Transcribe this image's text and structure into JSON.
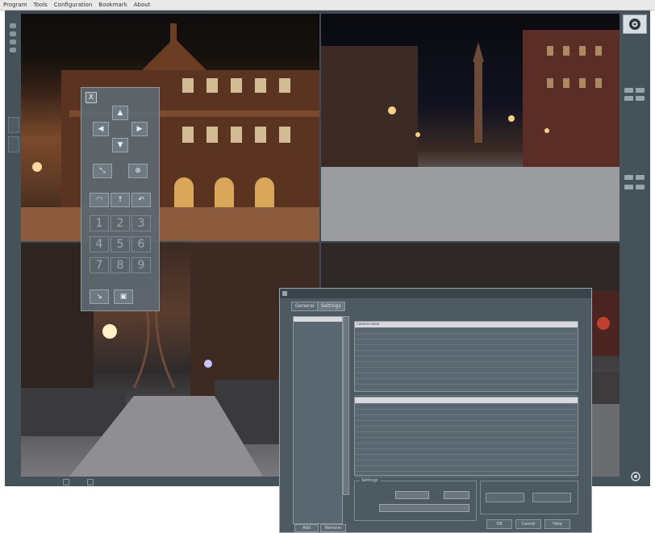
{
  "menu": [
    "Program",
    "Tools",
    "Configuration",
    "Bookmark",
    "About"
  ],
  "ptz": {
    "close_label": "X",
    "numbers": [
      "1",
      "2",
      "3",
      "4",
      "5",
      "6",
      "7",
      "8",
      "9"
    ]
  },
  "dialog": {
    "tabs": [
      "General",
      "Settings"
    ],
    "list_header": "",
    "list_items": [
      "",
      "",
      "",
      "",
      "",
      "",
      "",
      "",
      "",
      "",
      "",
      "",
      "",
      "",
      "",
      "",
      "",
      "",
      "",
      "",
      "",
      "",
      "",
      "",
      "",
      "",
      "",
      "",
      "",
      "",
      ""
    ],
    "table1_header": {
      "col1": "Camera name",
      "col2": "",
      "col3": ""
    },
    "table1_rows": 16,
    "table2_rows": 14,
    "btn_add": "Add",
    "btn_remove": "Remove",
    "btn_ok": "OK",
    "btn_cancel": "Cancel",
    "btn_help": "Help",
    "grp_left": "Settings",
    "grp_right": "",
    "btn_right1": "",
    "btn_right2": ""
  },
  "colors": {
    "app_bg": "#3f4a52",
    "panel": "#5c6870",
    "accent": "#d9dee2"
  }
}
